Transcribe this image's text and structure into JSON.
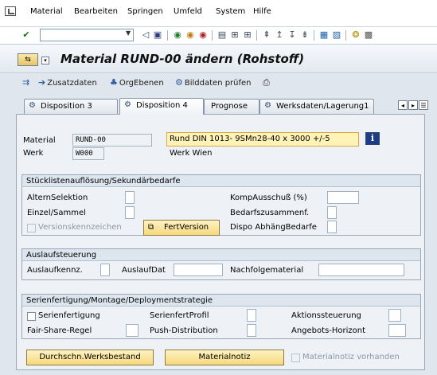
{
  "menu": {
    "items": [
      "Material",
      "Bearbeiten",
      "Springen",
      "Umfeld",
      "System",
      "Hilfe"
    ]
  },
  "toolbar": {
    "command_field": ""
  },
  "title": {
    "text": "Material RUND-00 ändern (Rohstoff)"
  },
  "app_toolbar": {
    "zusatzdaten": "Zusatzdaten",
    "orgebenen": "OrgEbenen",
    "bilddaten": "Bilddaten prüfen"
  },
  "tabs": [
    "Disposition 3",
    "Disposition 4",
    "Prognose",
    "Werksdaten/Lagerung1"
  ],
  "header": {
    "material_label": "Material",
    "material_value": "RUND-00",
    "material_desc": "Rund  DIN 1013- 9SMn28-40 x 3000 +/-5",
    "werk_label": "Werk",
    "werk_value": "W000",
    "werk_desc": "Werk Wien"
  },
  "group1": {
    "title": "Stücklistenauflösung/Sekundärbedarfe",
    "altern_selektion": "AlternSelektion",
    "einzel_sammel": "Einzel/Sammel",
    "versionskennzeichen": "Versionskennzeichen",
    "fertversion": "FertVersion",
    "kompausschuss": "KompAusschuß (%)",
    "bedarfszusammenf": "Bedarfszusammenf.",
    "dispo_abhaeng": "Dispo AbhängBedarfe"
  },
  "group2": {
    "title": "Auslaufsteuerung",
    "auslaufkennz": "Auslaufkennz.",
    "auslaufdat": "AuslaufDat",
    "nachfolgematerial": "Nachfolgematerial"
  },
  "group3": {
    "title": "Serienfertigung/Montage/Deploymentstrategie",
    "serienfertigung": "Serienfertigung",
    "serienfertprofil": "SerienfertProfil",
    "aktionssteuerung": "Aktionssteuerung",
    "fair_share": "Fair-Share-Regel",
    "push_distribution": "Push-Distribution",
    "angebots_horizont": "Angebots-Horizont"
  },
  "bottom": {
    "durchschn": "Durchschn.Werksbestand",
    "materialnotiz": "Materialnotiz",
    "materialnotiz_vorhanden": "Materialnotiz vorhanden"
  }
}
